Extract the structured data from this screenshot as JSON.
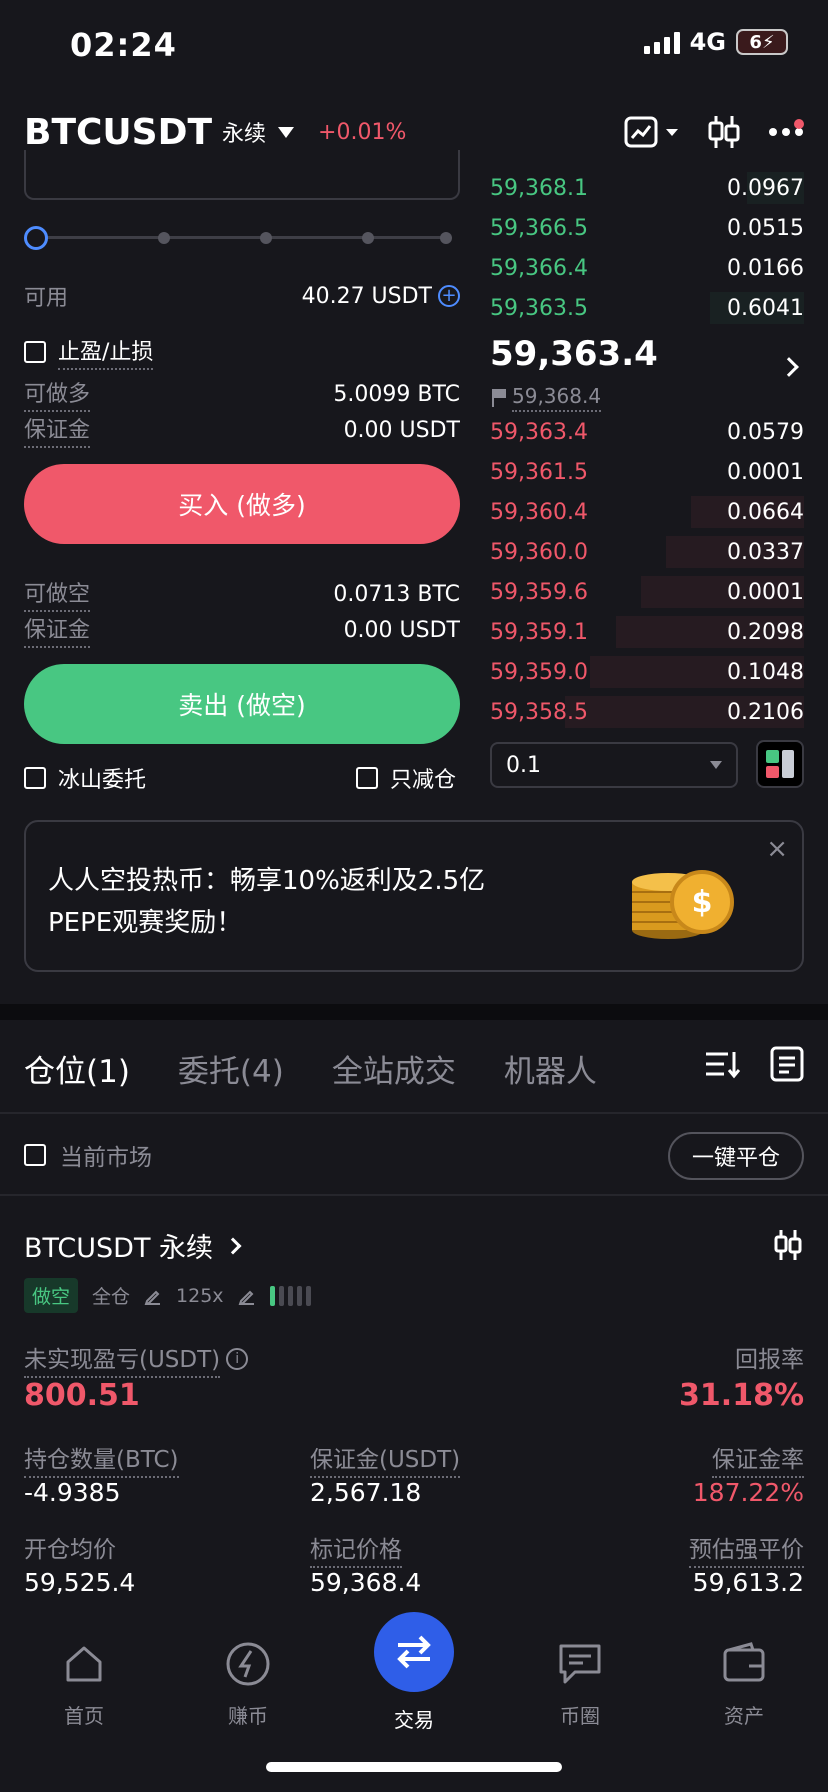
{
  "status_bar": {
    "time": "02:24",
    "network": "4G",
    "battery": "6"
  },
  "header": {
    "symbol": "BTCUSDT",
    "contract_type": "永续",
    "change": "+0.01%"
  },
  "order_form": {
    "available_label": "可用",
    "available_value": "40.27 USDT",
    "tpsl_label": "止盈/止损",
    "long_max_label": "可做多",
    "long_max_value": "5.0099 BTC",
    "long_margin_label": "保证金",
    "long_margin_value": "0.00 USDT",
    "buy_button": "买入 (做多)",
    "short_max_label": "可做空",
    "short_max_value": "0.0713 BTC",
    "short_margin_label": "保证金",
    "short_margin_value": "0.00 USDT",
    "sell_button": "卖出 (做空)",
    "iceberg_label": "冰山委托",
    "reduce_only_label": "只减仓"
  },
  "order_book": {
    "asks": [
      {
        "price": "59,368.1",
        "size": "0.0967"
      },
      {
        "price": "59,366.5",
        "size": "0.0515"
      },
      {
        "price": "59,366.4",
        "size": "0.0166"
      },
      {
        "price": "59,363.5",
        "size": "0.6041"
      }
    ],
    "last_price": "59,363.4",
    "mark_price": "59,368.4",
    "bids": [
      {
        "price": "59,363.4",
        "size": "0.0579"
      },
      {
        "price": "59,361.5",
        "size": "0.0001"
      },
      {
        "price": "59,360.4",
        "size": "0.0664"
      },
      {
        "price": "59,360.0",
        "size": "0.0337"
      },
      {
        "price": "59,359.6",
        "size": "0.0001"
      },
      {
        "price": "59,359.1",
        "size": "0.2098"
      },
      {
        "price": "59,359.0",
        "size": "0.1048"
      },
      {
        "price": "59,358.5",
        "size": "0.2106"
      }
    ],
    "depth_step": "0.1"
  },
  "banner": {
    "line1": "人人空投热币：畅享10%返利及2.5亿",
    "line2": "PEPE观赛奖励！",
    "close": "×"
  },
  "tabs": [
    {
      "label": "仓位(1)",
      "active": true
    },
    {
      "label": "委托(4)",
      "active": false
    },
    {
      "label": "全站成交",
      "active": false
    },
    {
      "label": "机器人",
      "active": false
    }
  ],
  "filter": {
    "current_market_label": "当前市场",
    "close_all_button": "一键平仓"
  },
  "position": {
    "title": "BTCUSDT 永续",
    "side_tag": "做空",
    "margin_mode": "全仓",
    "leverage": "125x",
    "upnl_label": "未实现盈亏(USDT)",
    "upnl_value": "800.51",
    "roe_label": "回报率",
    "roe_value": "31.18%",
    "size_label": "持仓数量(BTC)",
    "size_value": "-4.9385",
    "margin_label": "保证金(USDT)",
    "margin_value": "2,567.18",
    "margin_ratio_label": "保证金率",
    "margin_ratio_value": "187.22%",
    "entry_label": "开仓均价",
    "entry_value": "59,525.4",
    "mark_label": "标记价格",
    "mark_value": "59,368.4",
    "liq_label": "预估强平价",
    "liq_value": "59,613.2"
  },
  "bottom_nav": [
    {
      "label": "首页",
      "icon": "home-icon"
    },
    {
      "label": "赚币",
      "icon": "earn-icon"
    },
    {
      "label": "交易",
      "icon": "trade-icon"
    },
    {
      "label": "币圈",
      "icon": "feed-icon"
    },
    {
      "label": "资产",
      "icon": "wallet-icon"
    }
  ],
  "colors": {
    "green": "#48c782",
    "red": "#f0586a",
    "blue": "#2f5ee8",
    "bg": "#17171c"
  }
}
